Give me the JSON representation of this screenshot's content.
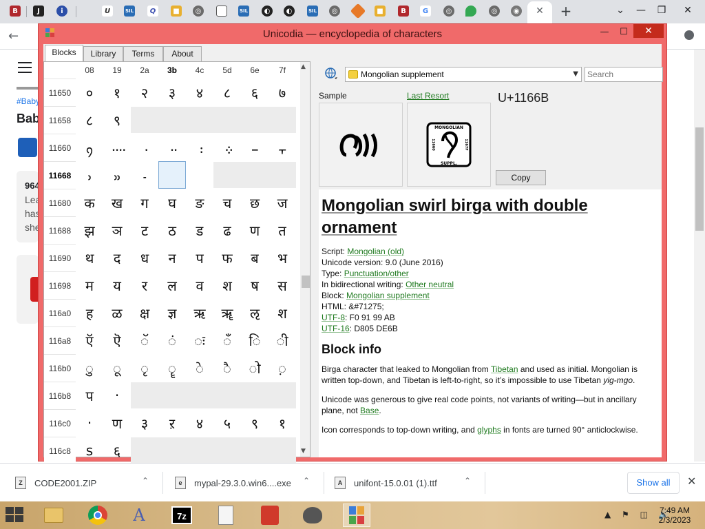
{
  "browser": {
    "active_tab_close": "✕",
    "new_tab": "+",
    "controls": {
      "dropdown": "⌄",
      "minimize": "—",
      "restore": "❐",
      "close": "✕"
    },
    "back": "←",
    "bg_page": {
      "text_tag": "#Baby",
      "text_bab": "Bab",
      "text_964": "964",
      "text_lea": "Lea",
      "text_has": "has",
      "text_she": "she"
    }
  },
  "window": {
    "title": "Unicodia — encyclopedia of characters",
    "min": "—",
    "max": "☐",
    "close": "✕",
    "tabs": [
      "Blocks",
      "Library",
      "Terms",
      "About"
    ]
  },
  "grid": {
    "columns": [
      "08",
      "19",
      "2a",
      "3b",
      "4c",
      "5d",
      "6e",
      "7f"
    ],
    "bold_column": 3,
    "rows": [
      {
        "code": "11650",
        "chars": [
          "०",
          "१",
          "२",
          "३",
          "४",
          "८",
          "६",
          "७"
        ]
      },
      {
        "code": "11658",
        "chars": [
          "८",
          "९"
        ]
      },
      {
        "code": "11660",
        "chars": [
          "᠀",
          "᠁",
          "᠂",
          "᠃",
          "᠄",
          "᠅",
          "᠆",
          "᠇"
        ]
      },
      {
        "code": "11668",
        "chars": [
          "᠈",
          "᠉",
          "᠊",
          "᠋",
          "᠌"
        ],
        "bold": true,
        "selected_col": 3
      },
      {
        "code": "11680",
        "chars": [
          "क",
          "ख",
          "ग",
          "घ",
          "ङ",
          "च",
          "छ",
          "ज"
        ]
      },
      {
        "code": "11688",
        "chars": [
          "झ",
          "ञ",
          "ट",
          "ठ",
          "ड",
          "ढ",
          "ण",
          "त"
        ]
      },
      {
        "code": "11690",
        "chars": [
          "थ",
          "द",
          "ध",
          "न",
          "प",
          "फ",
          "ब",
          "भ"
        ]
      },
      {
        "code": "11698",
        "chars": [
          "म",
          "य",
          "र",
          "ल",
          "व",
          "श",
          "ष",
          "स"
        ]
      },
      {
        "code": "116a0",
        "chars": [
          "ह",
          "ळ",
          "क्ष",
          "ज्ञ",
          "ऋ",
          "ॠ",
          "ऌ",
          "श"
        ]
      },
      {
        "code": "116a8",
        "chars": [
          "ऍ",
          "ऎ",
          "ॅ",
          "ं",
          "ः",
          "ँ",
          "ि",
          "ी"
        ]
      },
      {
        "code": "116b0",
        "chars": [
          "ु",
          "ू",
          "ृ",
          "ॄ",
          "े",
          "ै",
          "ो",
          "़"
        ]
      },
      {
        "code": "116b8",
        "chars": [
          "प",
          "·"
        ]
      },
      {
        "code": "116c0",
        "chars": [
          "·",
          "ण",
          "३",
          "ऱ",
          "४",
          "५",
          "९",
          "१"
        ]
      },
      {
        "code": "116c8",
        "chars": [
          "s",
          "६"
        ]
      }
    ]
  },
  "right": {
    "block_selector": "Mongolian supplement",
    "search_placeholder": "Search",
    "sample_label": "Sample",
    "last_resort_label": "Last Resort",
    "codepoint": "U+1166B",
    "sample_glyph": "ᠭ᠋",
    "lr_top": "MONGOLIAN",
    "lr_bottom": "SUPPL.",
    "lr_left": "11660",
    "lr_right": "1167F",
    "copy": "Copy",
    "char_name": "Mongolian swirl birga with double ornament",
    "props": {
      "script_label": "Script: ",
      "script_value": "Mongolian (old)",
      "version": "Unicode version: 9.0 (June 2016)",
      "type_label": "Type: ",
      "type_value": "Punctuation/other",
      "bidi_label": "In bidirectional writing: ",
      "bidi_value": "Other neutral",
      "block_label": "Block: ",
      "block_value": "Mongolian supplement",
      "html": "HTML: &#71275;",
      "utf8_label": "UTF-8",
      "utf8_value": ": F0 91 99 AB",
      "utf16_label": "UTF-16",
      "utf16_value": ": D805 DE6B"
    },
    "block_info_heading": "Block info",
    "p1_a": "Birga character that leaked to Mongolian from ",
    "p1_link": "Tibetan",
    "p1_b": " and used as initial. Mongolian is written top-down, and Tibetan is left-to-right, so it’s impossible to use Tibetan ",
    "p1_em": "yig-mgo",
    "p1_c": ".",
    "p2_a": "Unicode was generous to give real code points, not variants of writing—but in ancillary plane, not ",
    "p2_link": "Base",
    "p2_b": ".",
    "p3_a": "Icon corresponds to top-down writing, and ",
    "p3_link": "glyphs",
    "p3_b": " in fonts are turned 90° anticlockwise."
  },
  "downloads": [
    {
      "name": "CODE2001.ZIP",
      "icon": "Z"
    },
    {
      "name": "mypal-29.3.0.win6....exe",
      "icon": "e"
    },
    {
      "name": "unifont-15.0.01 (1).ttf",
      "icon": "A"
    }
  ],
  "download_chevron": "⌃",
  "show_all": "Show all",
  "download_close": "✕",
  "taskbar": {
    "time": "7:49 AM",
    "date": "2/3/2023",
    "tray": "▲ ⚑ ◫ 🔊"
  }
}
